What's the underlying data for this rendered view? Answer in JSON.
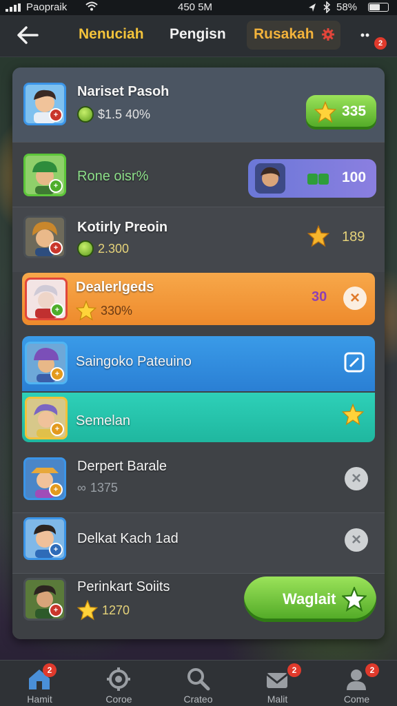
{
  "status_bar": {
    "carrier": "Paopraik",
    "time": "450 5M",
    "battery": "58%"
  },
  "header": {
    "tabs": [
      {
        "label": "Nenuciah"
      },
      {
        "label": "Pengisn"
      },
      {
        "label": "Rusakah"
      }
    ],
    "more_badge": "2"
  },
  "rows": [
    {
      "name": "Nariset Pasoh",
      "stat": "$1.5 40%",
      "action_label": "335",
      "avatar_badge": "+"
    },
    {
      "name": "Rone oisr%",
      "action_label": "100",
      "avatar_badge": "+"
    },
    {
      "name": "Kotirly Preoin",
      "stat": "2.300",
      "action_label": "189",
      "avatar_badge": "+"
    },
    {
      "name": "Dealerlgeds",
      "stat": "330%",
      "action_label": "30",
      "avatar_badge": "+"
    },
    {
      "name": "Saingoko Pateuino",
      "avatar_badge": "+"
    },
    {
      "name": "Semelan",
      "avatar_badge": "+"
    },
    {
      "name": "Derpert Barale",
      "stat": "1375",
      "avatar_badge": "+"
    },
    {
      "name": "Delkat Kach 1ad",
      "avatar_badge": "+"
    },
    {
      "name": "Perinkart Soiits",
      "stat": "1270",
      "action_label": "Waglait",
      "avatar_badge": "+"
    }
  ],
  "nav": [
    {
      "label": "Hamit",
      "badge": "2"
    },
    {
      "label": "Coroe",
      "badge": ""
    },
    {
      "label": "Crateo",
      "badge": ""
    },
    {
      "label": "Malit",
      "badge": "2"
    },
    {
      "label": "Come",
      "badge": "2"
    }
  ]
}
